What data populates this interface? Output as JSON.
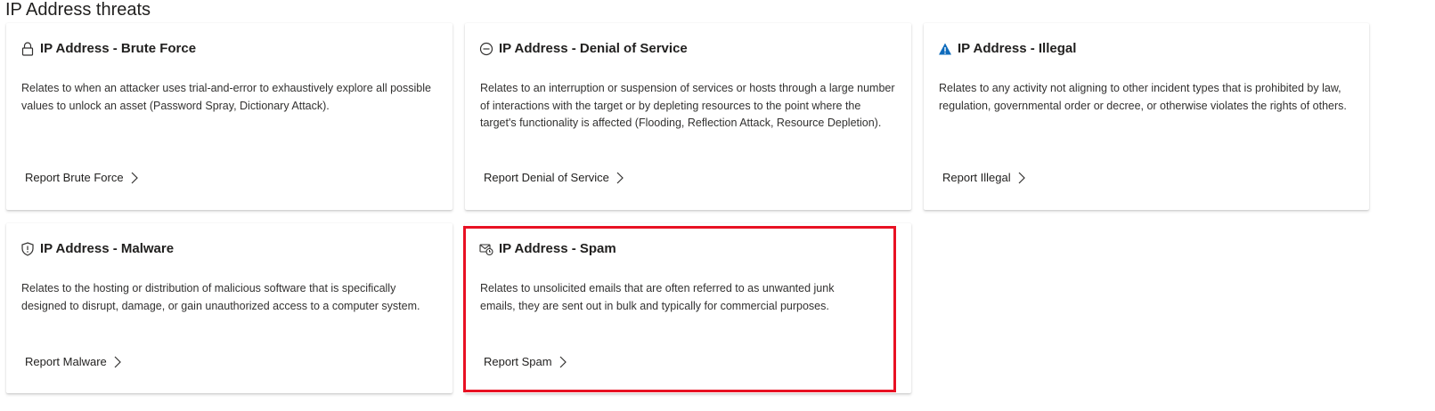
{
  "section": {
    "title": "IP Address threats"
  },
  "cards": [
    {
      "icon": "lock-icon",
      "title": "IP Address - Brute Force",
      "description": "Relates to when an attacker uses trial-and-error to exhaustively explore all possible values to unlock an asset (Password Spray, Dictionary Attack).",
      "action": "Report Brute Force"
    },
    {
      "icon": "blocked-circle-icon",
      "title": "IP Address - Denial of Service",
      "description": "Relates to an interruption or suspension of services or hosts through a large number of interactions with the target or by depleting resources to the point where the target's functionality is affected (Flooding, Reflection Attack, Resource Depletion).",
      "action": "Report Denial of Service"
    },
    {
      "icon": "warning-triangle-icon",
      "title": "IP Address - Illegal",
      "description": "Relates to any activity not aligning to other incident types that is prohibited by law, regulation, governmental order or decree, or otherwise violates the rights of others.",
      "action": "Report Illegal"
    },
    {
      "icon": "shield-alert-icon",
      "title": "IP Address - Malware",
      "description": "Relates to the hosting or distribution of malicious software that is specifically designed to disrupt, damage, or gain unauthorized access to a computer system.",
      "action": "Report Malware"
    },
    {
      "icon": "mail-clock-icon",
      "title": "IP Address - Spam",
      "description": "Relates to unsolicited emails that are often referred to as unwanted junk emails, they are sent out in bulk and typically for commercial purposes.",
      "action": "Report Spam"
    }
  ],
  "colors": {
    "highlight": "#e81123",
    "warning_icon": "#0f6cbd",
    "icon_stroke": "#323130"
  }
}
